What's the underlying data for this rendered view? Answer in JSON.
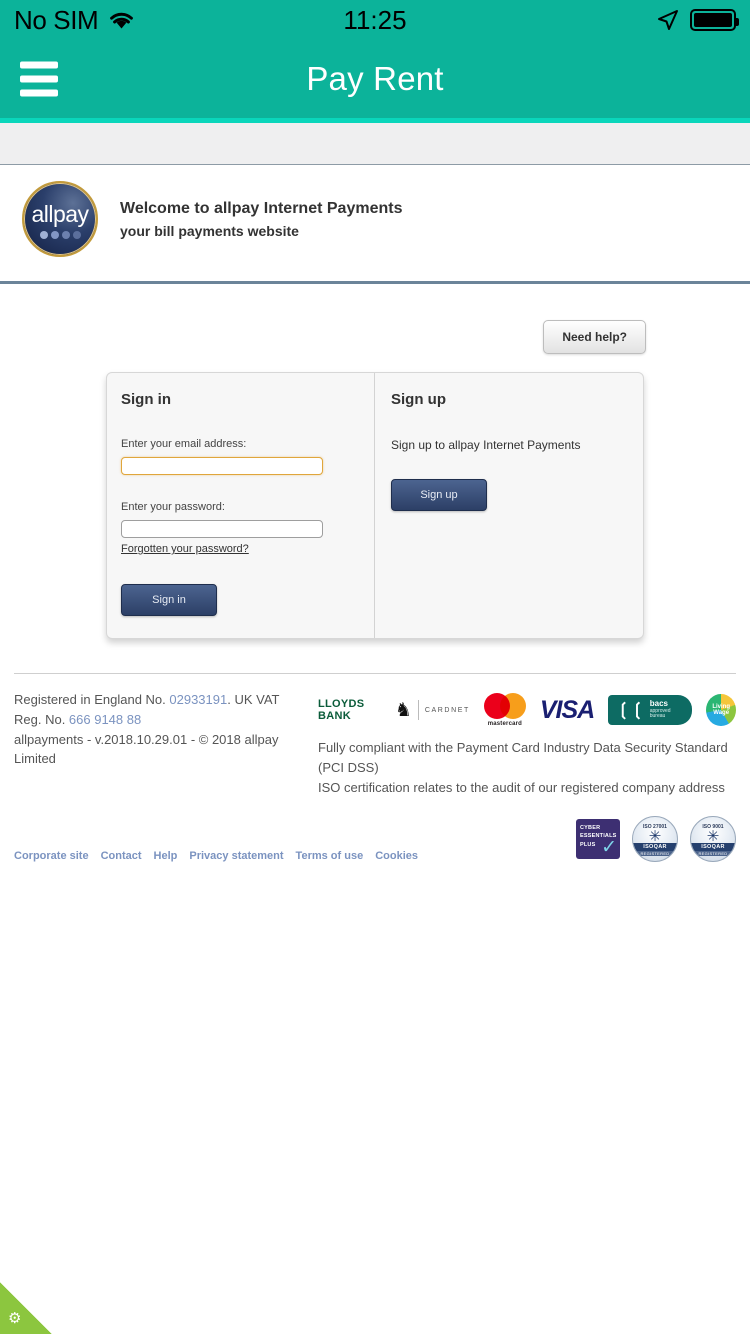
{
  "statusbar": {
    "carrier": "No SIM",
    "time": "11:25",
    "wifi_icon": "wifi-icon",
    "location_icon": "location-arrow-icon",
    "battery_icon": "battery-full-icon"
  },
  "navbar": {
    "menu_icon": "hamburger-menu-icon",
    "title": "Pay Rent"
  },
  "brand": {
    "logo_word": "allpay",
    "heading": "Welcome to allpay Internet Payments",
    "subheading": "your bill payments website"
  },
  "help": {
    "label": "Need help?"
  },
  "signin": {
    "title": "Sign in",
    "email_label": "Enter your email address:",
    "email_value": "",
    "email_placeholder": "",
    "password_label": "Enter your password:",
    "password_value": "",
    "password_placeholder": "",
    "forgot_label": "Forgotten your password?",
    "submit_label": "Sign in"
  },
  "signup": {
    "title": "Sign up",
    "text": "Sign up to allpay Internet Payments",
    "button_label": "Sign up"
  },
  "footer": {
    "registration_line1_a": "Registered in England No. ",
    "registration_no": "02933191",
    "registration_line1_b": ". UK VAT Reg. No. ",
    "vat_no": "666 9148 88",
    "version_line": "allpayments - v.2018.10.29.01 - © 2018 allpay Limited",
    "compliance_line1": "Fully compliant with the Payment Card Industry Data Security Standard (PCI DSS)",
    "compliance_line2": "ISO certification relates to the audit of our registered company address",
    "links": [
      {
        "label": "Corporate site"
      },
      {
        "label": "Contact"
      },
      {
        "label": "Help"
      },
      {
        "label": "Privacy statement"
      },
      {
        "label": "Terms of use"
      },
      {
        "label": "Cookies"
      }
    ],
    "partner_logos": {
      "lloyds_name": "LLOYDS BANK",
      "cardnet": "CARDNET",
      "mastercard_label": "mastercard",
      "visa_label": "VISA",
      "bacs_line1": "bacs",
      "bacs_line2": "approved bureau",
      "livingwage_label": "Living Wage"
    },
    "badges": {
      "cyber_line1": "CYBER",
      "cyber_line2": "ESSENTIALS",
      "cyber_line3": "PLUS",
      "iso_27001_top": "ISO 27001",
      "iso_27001_name": "ISOQAR",
      "iso_27001_sub": "REGISTERED",
      "iso_9001_top": "ISO 9001",
      "iso_9001_name": "ISOQAR",
      "iso_9001_sub": "REGISTERED"
    }
  },
  "corner": {
    "gear_icon": "gear-icon"
  },
  "colors": {
    "header_teal": "#0cb39a",
    "header_underline": "#0ad6bb",
    "link_blue": "#7b93c0",
    "button_navy": "#2c3f66",
    "focus_gold": "#e0a63c",
    "corner_green": "#8cc63f"
  }
}
